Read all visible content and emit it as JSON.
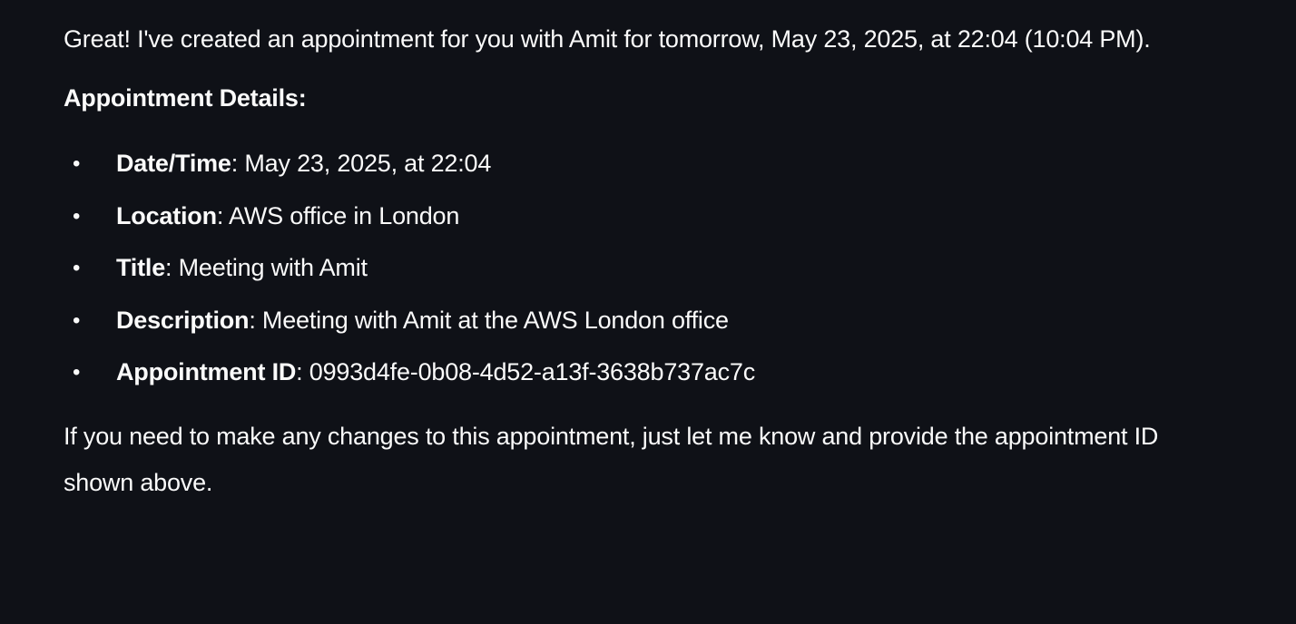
{
  "message": {
    "intro": "Great! I've created an appointment for you with Amit for tomorrow, May 23, 2025, at 22:04 (10:04 PM).",
    "details_heading": "Appointment Details:",
    "details": [
      {
        "label": "Date/Time",
        "value": ": May 23, 2025, at 22:04"
      },
      {
        "label": "Location",
        "value": ": AWS office in London"
      },
      {
        "label": "Title",
        "value": ": Meeting with Amit"
      },
      {
        "label": "Description",
        "value": ": Meeting with Amit at the AWS London office"
      },
      {
        "label": "Appointment ID",
        "value": ": 0993d4fe-0b08-4d52-a13f-3638b737ac7c"
      }
    ],
    "footer": "If you need to make any changes to this appointment, just let me know and provide the appointment ID shown above."
  },
  "colors": {
    "background": "#0f1117",
    "text": "#fafafa"
  }
}
